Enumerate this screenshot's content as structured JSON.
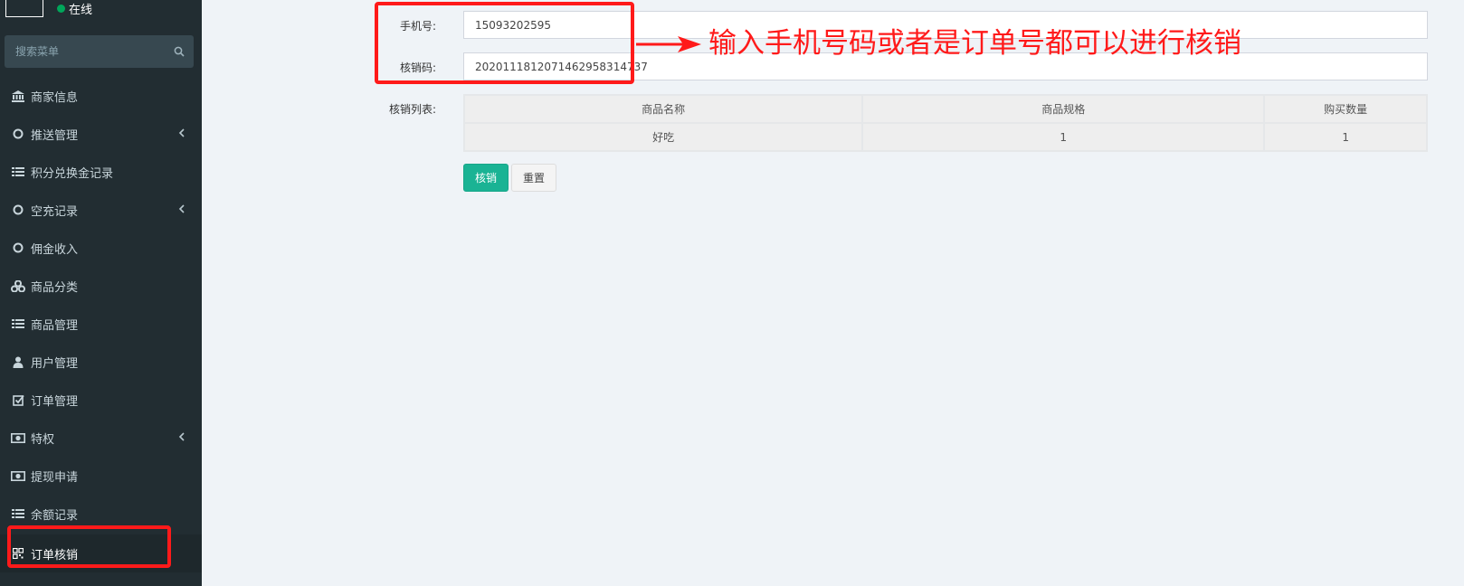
{
  "sidebar": {
    "user_status": "在线",
    "search_placeholder": "搜索菜单",
    "items": [
      {
        "label": "商家信息",
        "icon": "bank-icon",
        "has_chevron": false
      },
      {
        "label": "推送管理",
        "icon": "circle-icon",
        "has_chevron": true
      },
      {
        "label": "积分兑换金记录",
        "icon": "list-icon",
        "has_chevron": false
      },
      {
        "label": "空充记录",
        "icon": "circle-icon",
        "has_chevron": true
      },
      {
        "label": "佣金收入",
        "icon": "circle-icon",
        "has_chevron": false
      },
      {
        "label": "商品分类",
        "icon": "cubes-icon",
        "has_chevron": false
      },
      {
        "label": "商品管理",
        "icon": "list-icon",
        "has_chevron": false
      },
      {
        "label": "用户管理",
        "icon": "user-icon",
        "has_chevron": false
      },
      {
        "label": "订单管理",
        "icon": "check-square-icon",
        "has_chevron": false
      },
      {
        "label": "特权",
        "icon": "money-icon",
        "has_chevron": true
      },
      {
        "label": "提现申请",
        "icon": "money-icon",
        "has_chevron": false
      },
      {
        "label": "余额记录",
        "icon": "list-icon",
        "has_chevron": false
      },
      {
        "label": "订单核销",
        "icon": "qrcode-icon",
        "has_chevron": false,
        "active": true
      }
    ]
  },
  "form": {
    "phone_label": "手机号:",
    "phone_value": "15093202595",
    "code_label": "核销码:",
    "code_value": "2020111812071462958314737",
    "list_label": "核销列表:",
    "table": {
      "headers": [
        "商品名称",
        "商品规格",
        "购买数量"
      ],
      "rows": [
        [
          "好吃",
          "1",
          "1"
        ]
      ]
    },
    "verify_button": "核销",
    "reset_button": "重置"
  },
  "annotation": {
    "text": "输入手机号码或者是订单号都可以进行核销",
    "color": "#ff1a1a"
  },
  "colors": {
    "sidebar_bg": "#222d32",
    "accent_green": "#1ab394",
    "page_bg": "#eff3f7"
  }
}
